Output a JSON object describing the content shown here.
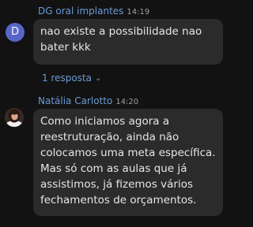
{
  "messages": [
    {
      "avatar_letter": "D",
      "sender": "DG oral implantes",
      "time": "14:19",
      "lines": [
        "nao existe a possibilidade nao",
        "bater kkk"
      ],
      "replies_label": "1 resposta",
      "replies_icon": "chevron-down-icon"
    },
    {
      "sender": "Natália Carlotto",
      "time": "14:20",
      "lines": [
        "Como iniciamos agora a",
        "reestruturação, ainda não",
        "colocamos uma meta específica.",
        "Mas só com as aulas que já",
        "assistimos, já fizemos vários",
        "fechamentos de orçamentos."
      ]
    }
  ],
  "colors": {
    "background": "#121212",
    "bubble": "#2b2b2b",
    "accent_name": "#6b9bd6",
    "avatar_d": "#5865c8"
  }
}
